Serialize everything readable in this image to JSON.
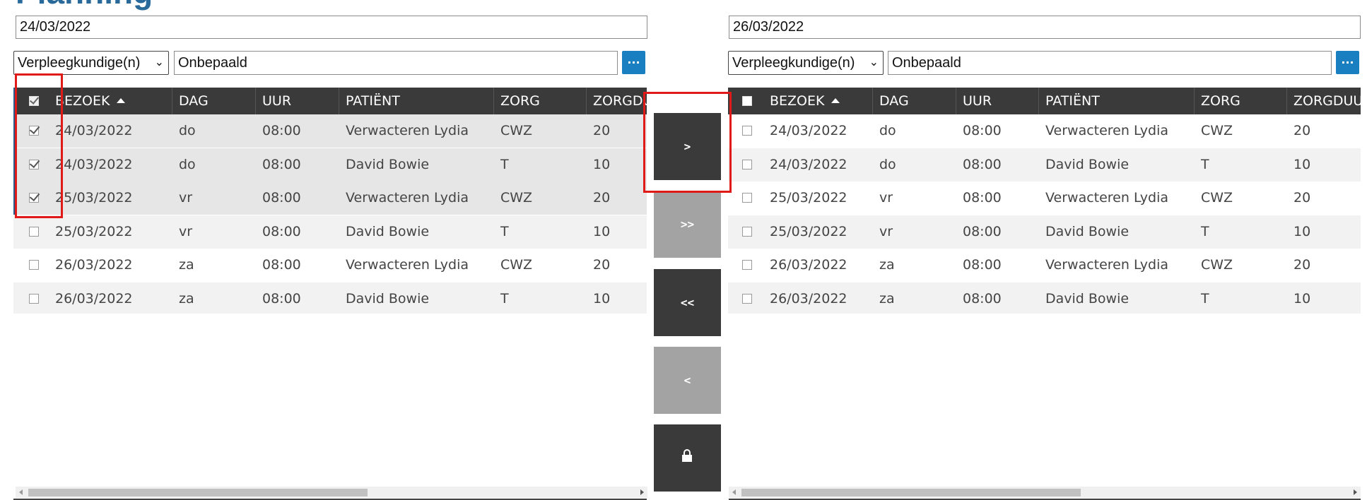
{
  "page": {
    "title": "Planning"
  },
  "left": {
    "date": "24/03/2022",
    "role": "Verpleegkundige(n)",
    "name": "Onbepaald",
    "more_label": "...",
    "header_checked": true,
    "columns": [
      "BEZOEK",
      "DAG",
      "UUR",
      "PATIËNT",
      "ZORG",
      "ZORGDUUR"
    ],
    "rows": [
      {
        "checked": true,
        "bezoek": "24/03/2022",
        "dag": "do",
        "uur": "08:00",
        "patient": "Verwacteren Lydia",
        "zorg": "CWZ",
        "duur": "20"
      },
      {
        "checked": true,
        "bezoek": "24/03/2022",
        "dag": "do",
        "uur": "08:00",
        "patient": "David Bowie",
        "zorg": "T",
        "duur": "10"
      },
      {
        "checked": true,
        "bezoek": "25/03/2022",
        "dag": "vr",
        "uur": "08:00",
        "patient": "Verwacteren Lydia",
        "zorg": "CWZ",
        "duur": "20"
      },
      {
        "checked": false,
        "bezoek": "25/03/2022",
        "dag": "vr",
        "uur": "08:00",
        "patient": "David Bowie",
        "zorg": "T",
        "duur": "10"
      },
      {
        "checked": false,
        "bezoek": "26/03/2022",
        "dag": "za",
        "uur": "08:00",
        "patient": "Verwacteren Lydia",
        "zorg": "CWZ",
        "duur": "20"
      },
      {
        "checked": false,
        "bezoek": "26/03/2022",
        "dag": "za",
        "uur": "08:00",
        "patient": "David Bowie",
        "zorg": "T",
        "duur": "10"
      }
    ]
  },
  "right": {
    "date": "26/03/2022",
    "role": "Verpleegkundige(n)",
    "name": "Onbepaald",
    "more_label": "...",
    "header_checked": false,
    "columns": [
      "BEZOEK",
      "DAG",
      "UUR",
      "PATIËNT",
      "ZORG",
      "ZORGDUUR"
    ],
    "rows": [
      {
        "checked": false,
        "bezoek": "24/03/2022",
        "dag": "do",
        "uur": "08:00",
        "patient": "Verwacteren Lydia",
        "zorg": "CWZ",
        "duur": "20"
      },
      {
        "checked": false,
        "bezoek": "24/03/2022",
        "dag": "do",
        "uur": "08:00",
        "patient": "David Bowie",
        "zorg": "T",
        "duur": "10"
      },
      {
        "checked": false,
        "bezoek": "25/03/2022",
        "dag": "vr",
        "uur": "08:00",
        "patient": "Verwacteren Lydia",
        "zorg": "CWZ",
        "duur": "20"
      },
      {
        "checked": false,
        "bezoek": "25/03/2022",
        "dag": "vr",
        "uur": "08:00",
        "patient": "David Bowie",
        "zorg": "T",
        "duur": "10"
      },
      {
        "checked": false,
        "bezoek": "26/03/2022",
        "dag": "za",
        "uur": "08:00",
        "patient": "Verwacteren Lydia",
        "zorg": "CWZ",
        "duur": "20"
      },
      {
        "checked": false,
        "bezoek": "26/03/2022",
        "dag": "za",
        "uur": "08:00",
        "patient": "David Bowie",
        "zorg": "T",
        "duur": "10"
      }
    ]
  },
  "transfer": {
    "move_selected": ">",
    "move_all": ">>",
    "move_all_back": "<<",
    "move_selected_back": "<",
    "lock_icon": "lock-icon"
  },
  "colors": {
    "header_bg": "#3a3a3a",
    "accent": "#1a7fc1",
    "highlight": "#e01919",
    "title": "#2a6a9b"
  }
}
